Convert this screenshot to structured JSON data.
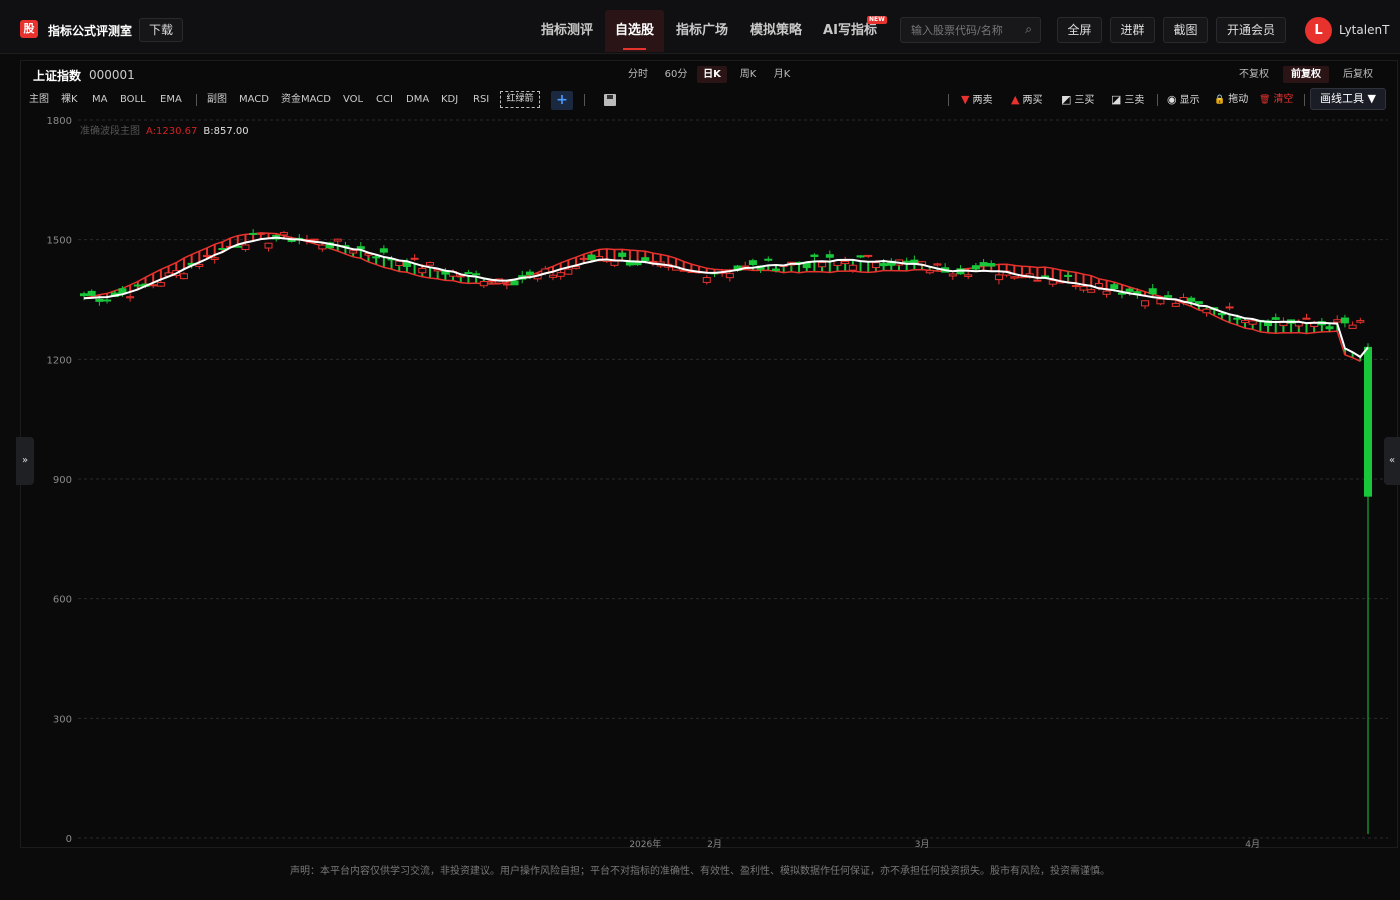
{
  "app": {
    "logo_char": "股",
    "title": "指标公式评测室",
    "download": "下载"
  },
  "nav": [
    {
      "label": "指标测评"
    },
    {
      "label": "自选股"
    },
    {
      "label": "指标广场"
    },
    {
      "label": "模拟策略"
    },
    {
      "label": "AI写指标",
      "badge": "NEW"
    }
  ],
  "search": {
    "placeholder": "输入股票代码/名称"
  },
  "top_buttons": [
    "全屏",
    "进群",
    "截图",
    "开通会员"
  ],
  "user": {
    "initial": "L",
    "name": "LytalenT"
  },
  "stock": {
    "name": "上证指数",
    "code": "000001"
  },
  "periods": [
    "分时",
    "60分",
    "日K",
    "周K",
    "月K"
  ],
  "fq": [
    "不复权",
    "前复权",
    "后复权"
  ],
  "indicators_main": [
    "主图",
    "裸K",
    "MA",
    "BOLL",
    "EMA"
  ],
  "indicators_sub": [
    "副图",
    "MACD",
    "资金MACD",
    "VOL",
    "CCI",
    "DMA",
    "KDJ",
    "RSI"
  ],
  "highlight_indicator": "红绿箭",
  "tools": [
    {
      "icon": "▼",
      "label": "两卖",
      "color": "#e8322e"
    },
    {
      "icon": "▲",
      "label": "两买",
      "color": "#e8322e"
    },
    {
      "icon": "◩",
      "label": "三买",
      "color": "#dddddd"
    },
    {
      "icon": "◪",
      "label": "三卖",
      "color": "#dddddd"
    },
    {
      "icon": "◉",
      "label": "显示",
      "color": "#dddddd"
    },
    {
      "icon": "🔒",
      "label": "拖动",
      "color": "#dddddd"
    },
    {
      "icon": "🗑",
      "label": "清空",
      "color": "#e8322e"
    }
  ],
  "draw_tool": "画线工具 ▼",
  "side_left": "»",
  "side_right": "«",
  "legend": {
    "main": "准确波段主图",
    "a": "A:1230.67",
    "b": "B:857.00"
  },
  "chart_data": {
    "type": "candlestick",
    "ylim": [
      0,
      1800
    ],
    "yticks": [
      0,
      300,
      600,
      900,
      1200,
      1500,
      1800
    ],
    "xticks": [
      {
        "label": "2026年",
        "index": 73
      },
      {
        "label": "2月",
        "index": 82
      },
      {
        "label": "3月",
        "index": 109
      },
      {
        "label": "4月",
        "index": 152
      }
    ],
    "count": 168,
    "grid": true,
    "colors": {
      "up": "#e8322e",
      "down": "#18c83a",
      "line": "#ffffff",
      "band_red": "#e8322e",
      "band_green": "#18c83a"
    }
  },
  "footer": "声明：本平台内容仅供学习交流，非投资建议。用户操作风险自担；平台不对指标的准确性、有效性、盈利性、模拟数据作任何保证，亦不承担任何投资损失。股市有风险，投资需谨慎。"
}
